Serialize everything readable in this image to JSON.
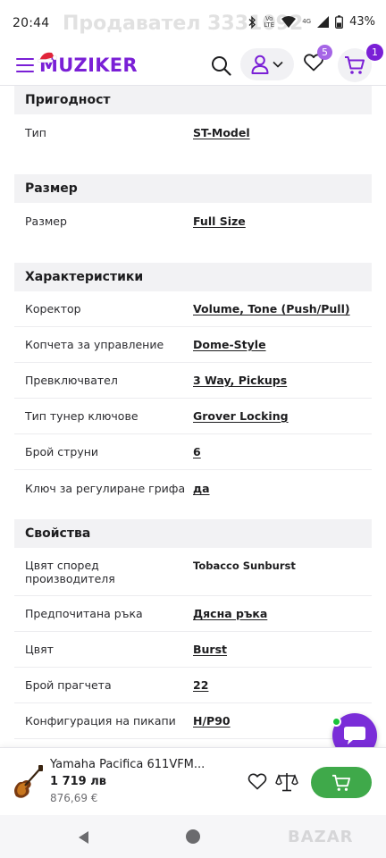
{
  "status_bar": {
    "time": "20:44",
    "watermark": "Продавател 3331092",
    "network_label": "4G",
    "volte_label": "Vo LTE",
    "battery": "43%"
  },
  "header": {
    "logo_text": "MUZIKER",
    "favorites_count": "5",
    "cart_count": "1",
    "icons": [
      "menu-icon",
      "search-icon",
      "user-icon",
      "heart-icon",
      "cart-icon"
    ]
  },
  "sections": [
    {
      "title": "Пригодност",
      "rows": [
        {
          "label": "Тип",
          "value": "ST-Model",
          "link": true
        }
      ]
    },
    {
      "title": "Размер",
      "rows": [
        {
          "label": "Размер",
          "value": "Full Size",
          "link": true
        }
      ]
    },
    {
      "title": "Характеристики",
      "rows": [
        {
          "label": "Коректор",
          "value": "Volume, Tone (Push/Pull)",
          "link": true
        },
        {
          "label": "Копчета за управление",
          "value": "Dome-Style",
          "link": true
        },
        {
          "label": "Превключвател",
          "value": "3 Way, Pickups",
          "link": true
        },
        {
          "label": "Тип тунер ключове",
          "value": "Grover Locking",
          "link": true
        },
        {
          "label": "Брой струни",
          "value": "6",
          "link": true
        },
        {
          "label": "Ключ за регулиране грифа",
          "value": "да",
          "link": true
        }
      ]
    },
    {
      "title": "Свойства",
      "rows": [
        {
          "label": "Цвят според производителя",
          "value": "Tobacco Sunburst",
          "link": false
        },
        {
          "label": "Предпочитана ръка",
          "value": "Дясна ръка",
          "link": true
        },
        {
          "label": "Цвят",
          "value": "Burst",
          "link": true
        },
        {
          "label": "Брой прагчета",
          "value": "22",
          "link": true
        },
        {
          "label": "Конфигурация на пикапи",
          "value": "H/P90",
          "link": true
        }
      ]
    }
  ],
  "product_bar": {
    "name": "Yamaha Pacifica 611VFM...",
    "price": "1 719 лв",
    "price_eur": "876,69 €"
  },
  "nav_bar": {
    "watermark": "BAZAR"
  },
  "colors": {
    "brand": "#7a1fd6",
    "add_to_cart": "#3fa94a",
    "online": "#19c23a"
  }
}
